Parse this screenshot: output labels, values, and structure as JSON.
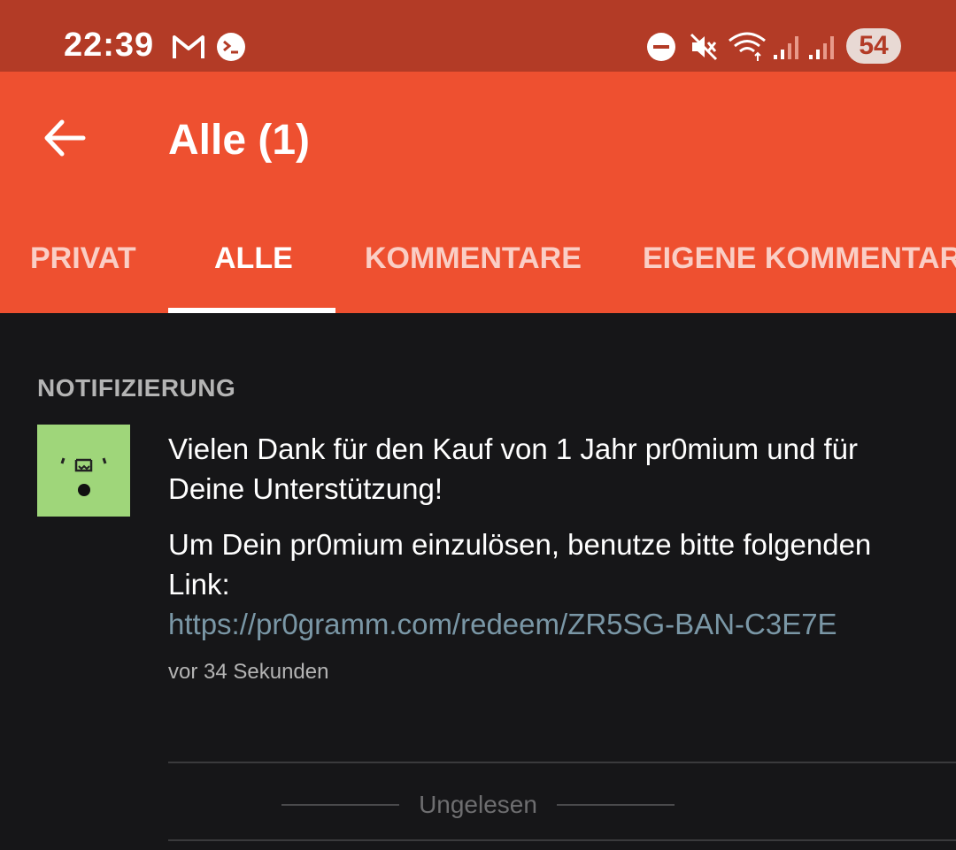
{
  "status_bar": {
    "time": "22:39",
    "battery": "54",
    "icons": [
      "gmail-icon",
      "terminal-icon",
      "do-not-disturb-icon",
      "mute-icon",
      "wifi-icon",
      "signal-icon",
      "signal-icon"
    ]
  },
  "app_bar": {
    "title": "Alle (1)",
    "back_icon": "arrow-left-icon"
  },
  "tabs": [
    {
      "label": "PRIVAT",
      "active": false
    },
    {
      "label": "ALLE",
      "active": true
    },
    {
      "label": "KOMMENTARE",
      "active": false
    },
    {
      "label": "EIGENE KOMMENTARE",
      "active": false
    }
  ],
  "notification": {
    "section_title": "NOTIFIZIERUNG",
    "line1": "Vielen Dank für den Kauf von 1 Jahr pr0mium und für Deine Unterstützung!",
    "line2": "Um Dein pr0mium einzulösen, benutze bitte folgenden Link:",
    "link": "https://pr0gramm.com/redeem/ZR5SG-BAN-C3E7E",
    "time_ago": "vor 34 Sekunden"
  },
  "unread_label": "Ungelesen",
  "colors": {
    "status_bar": "#b33b26",
    "app_bar": "#ee5030",
    "background": "#161618",
    "link": "#7a97a6",
    "avatar": "#9fd67a"
  }
}
